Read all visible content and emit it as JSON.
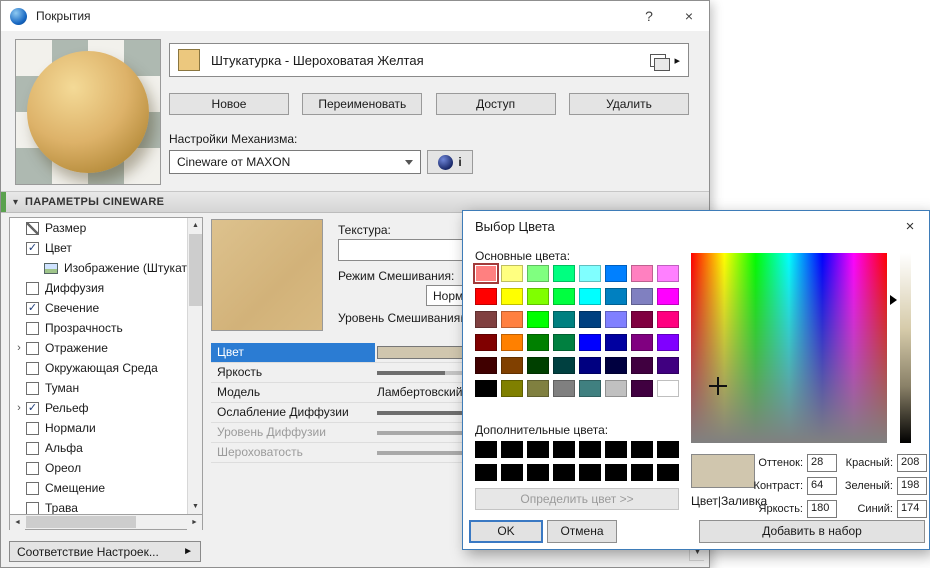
{
  "glyphs": {
    "up": "▲",
    "down": "▼",
    "left": "◄",
    "right": "►",
    "expand": "›",
    "check": "✓",
    "flyout": "▸",
    "section_collapse": "▾"
  },
  "window": {
    "title": "Покрытия",
    "help_label": "?",
    "close_label": "×"
  },
  "material": {
    "name": "Штукатурка - Шероховатая Желтая",
    "swatch_color": "#ecc87e",
    "action_buttons": [
      "Новое",
      "Переименовать",
      "Доступ",
      "Удалить"
    ],
    "engine_label": "Настройки Механизма:",
    "engine_value": "Cineware от MAXON",
    "engine_info_label": "i"
  },
  "section_title": "ПАРАМЕТРЫ CINEWARE",
  "tree": {
    "items": [
      {
        "label": "Размер",
        "icon": "size"
      },
      {
        "label": "Цвет",
        "checked": true
      },
      {
        "label": "Изображение (Штукат",
        "icon": "image",
        "indent": 1
      },
      {
        "label": "Диффузия",
        "checked": false
      },
      {
        "label": "Свечение",
        "checked": true
      },
      {
        "label": "Прозрачность",
        "checked": false
      },
      {
        "label": "Отражение",
        "checked": false,
        "expand": true
      },
      {
        "label": "Окружающая Среда",
        "checked": false
      },
      {
        "label": "Туман",
        "checked": false
      },
      {
        "label": "Рельеф",
        "checked": true,
        "expand": true
      },
      {
        "label": "Нормали",
        "checked": false
      },
      {
        "label": "Альфа",
        "checked": false
      },
      {
        "label": "Ореол",
        "checked": false
      },
      {
        "label": "Смещение",
        "checked": false
      },
      {
        "label": "Трава",
        "checked": false
      }
    ]
  },
  "match_button": "Соответствие Настроек...",
  "properties": {
    "texture_label": "Текстура:",
    "blend_mode_label": "Режим Смешивания:",
    "blend_mode_value": "Нормальный",
    "blend_level_label": "Уровень Смешивания:",
    "blend_level_fill": 62,
    "rows": [
      {
        "label": "Цвет",
        "type": "swatch",
        "selected": true,
        "swatch_color": "#d0c6ae"
      },
      {
        "label": "Яркость",
        "type": "slider",
        "fill": 22
      },
      {
        "label": "Модель",
        "type": "text",
        "value": "Ламбертовский"
      },
      {
        "label": "Ослабление Диффузии",
        "type": "slider",
        "fill": 34
      },
      {
        "label": "Уровень Диффузии",
        "type": "slider",
        "fill": 48,
        "disabled": true
      },
      {
        "label": "Шероховатость",
        "type": "slider",
        "fill": 30,
        "disabled": true
      }
    ]
  },
  "color_picker": {
    "title": "Выбор Цвета",
    "close_label": "×",
    "basic_label": "Основные цвета:",
    "custom_label": "Дополнительные цвета:",
    "define_button": "Определить цвет >>",
    "preview_label": "Цвет|Заливка",
    "preview_color": "#d0c6ae",
    "selected_basic_index": 0,
    "basic_colors": [
      "#FF8080",
      "#FFFF80",
      "#80FF80",
      "#00FF80",
      "#80FFFF",
      "#0080FF",
      "#FF80C0",
      "#FF80FF",
      "#FF0000",
      "#FFFF00",
      "#80FF00",
      "#00FF40",
      "#00FFFF",
      "#0080C0",
      "#8080C0",
      "#FF00FF",
      "#804040",
      "#FF8040",
      "#00FF00",
      "#008080",
      "#004080",
      "#8080FF",
      "#800040",
      "#FF0080",
      "#800000",
      "#FF8000",
      "#008000",
      "#008040",
      "#0000FF",
      "#0000A0",
      "#800080",
      "#8000FF",
      "#400000",
      "#804000",
      "#004000",
      "#004040",
      "#000080",
      "#000040",
      "#400040",
      "#400080",
      "#000000",
      "#808000",
      "#808040",
      "#808080",
      "#408080",
      "#C0C0C0",
      "#400040",
      "#FFFFFF"
    ],
    "custom_colors": [
      "#000000",
      "#000000",
      "#000000",
      "#000000",
      "#000000",
      "#000000",
      "#000000",
      "#000000",
      "#000000",
      "#000000",
      "#000000",
      "#000000",
      "#000000",
      "#000000",
      "#000000",
      "#000000"
    ],
    "hsl_fields": [
      {
        "label": "Оттенок:",
        "value": "28"
      },
      {
        "label": "Контраст:",
        "value": "64"
      },
      {
        "label": "Яркость:",
        "value": "180"
      }
    ],
    "rgb_fields": [
      {
        "label": "Красный:",
        "value": "208"
      },
      {
        "label": "Зеленый:",
        "value": "198"
      },
      {
        "label": "Синий:",
        "value": "174"
      }
    ],
    "ok_button": "OK",
    "cancel_button": "Отмена",
    "add_button": "Добавить в набор"
  }
}
